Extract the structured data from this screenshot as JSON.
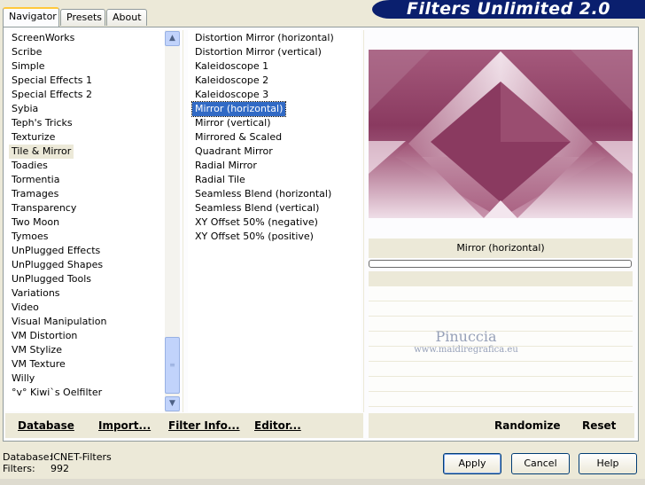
{
  "tabs": [
    {
      "label": "Navigator",
      "active": true
    },
    {
      "label": "Presets",
      "active": false
    },
    {
      "label": "About",
      "active": false
    }
  ],
  "brand": "Filters Unlimited 2.0",
  "categories": [
    {
      "label": "ScreenWorks"
    },
    {
      "label": "Scribe"
    },
    {
      "label": "Simple"
    },
    {
      "label": "Special Effects 1"
    },
    {
      "label": "Special Effects 2"
    },
    {
      "label": "Sybia"
    },
    {
      "label": "Teph's Tricks"
    },
    {
      "label": "Texturize"
    },
    {
      "label": "Tile & Mirror",
      "selected": true
    },
    {
      "label": "Toadies"
    },
    {
      "label": "Tormentia"
    },
    {
      "label": "Tramages"
    },
    {
      "label": "Transparency"
    },
    {
      "label": "Two Moon"
    },
    {
      "label": "Tymoes"
    },
    {
      "label": "UnPlugged Effects"
    },
    {
      "label": "UnPlugged Shapes"
    },
    {
      "label": "UnPlugged Tools"
    },
    {
      "label": "Variations"
    },
    {
      "label": "Video"
    },
    {
      "label": "Visual Manipulation"
    },
    {
      "label": "VM Distortion"
    },
    {
      "label": "VM Stylize"
    },
    {
      "label": "VM Texture"
    },
    {
      "label": "Willy"
    },
    {
      "label": "°v° Kiwi`s Oelfilter"
    }
  ],
  "filters": [
    {
      "label": "Distortion Mirror (horizontal)"
    },
    {
      "label": "Distortion Mirror (vertical)"
    },
    {
      "label": "Kaleidoscope 1"
    },
    {
      "label": "Kaleidoscope 2"
    },
    {
      "label": "Kaleidoscope 3"
    },
    {
      "label": "Mirror (horizontal)",
      "selected": true
    },
    {
      "label": "Mirror (vertical)"
    },
    {
      "label": "Mirrored & Scaled"
    },
    {
      "label": "Quadrant Mirror"
    },
    {
      "label": "Radial Mirror"
    },
    {
      "label": "Radial Tile"
    },
    {
      "label": "Seamless Blend (horizontal)"
    },
    {
      "label": "Seamless Blend (vertical)"
    },
    {
      "label": "XY Offset 50% (negative)"
    },
    {
      "label": "XY Offset 50% (positive)"
    }
  ],
  "preview": {
    "filter_name": "Mirror (horizontal)",
    "colors": {
      "dark": "#8a3a60",
      "mid": "#b27894",
      "light": "#f3e6ee"
    }
  },
  "watermark": {
    "line1": "Pinuccia",
    "line2": "www.maidiregrafica.eu"
  },
  "toolbar": {
    "database": "Database",
    "import": "Import...",
    "filter_info": "Filter Info...",
    "editor": "Editor...",
    "randomize": "Randomize",
    "reset": "Reset"
  },
  "status": {
    "database_label": "Database:",
    "database_value": "ICNET-Filters",
    "filters_label": "Filters:",
    "filters_value": "992"
  },
  "buttons": {
    "apply": "Apply",
    "cancel": "Cancel",
    "help": "Help"
  },
  "scrollbar": {
    "up_icon": "chevron-up-icon",
    "down_icon": "chevron-down-icon"
  }
}
